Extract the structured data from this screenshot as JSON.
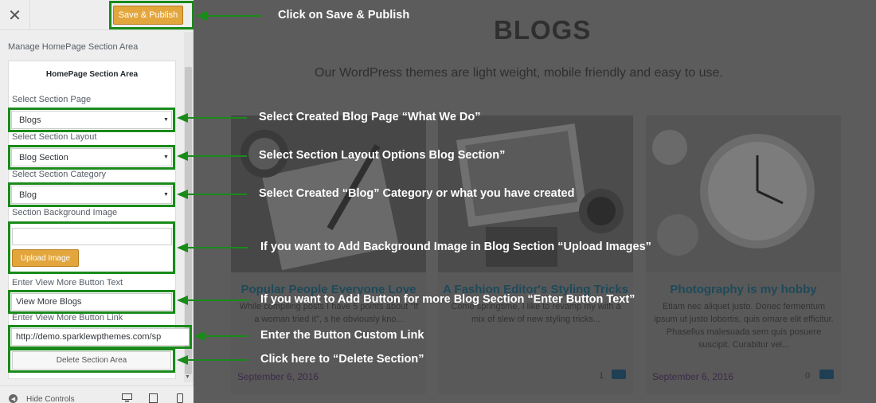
{
  "panel": {
    "close_icon": "close-icon",
    "save_label": "Save & Publish",
    "section_crumb": "Manage HomePage Section Area",
    "area_title": "HomePage Section Area",
    "fields": {
      "section_page_label": "Select Section Page",
      "section_page_value": "Blogs",
      "section_layout_label": "Select Section Layout",
      "section_layout_value": "Blog Section",
      "section_category_label": "Select Section Category",
      "section_category_value": "Blog",
      "bg_image_label": "Section Background Image",
      "upload_label": "Upload Image",
      "view_more_text_label": "Enter View More Button Text",
      "view_more_text_value": "View More Blogs",
      "view_more_link_label": "Enter View More Button Link",
      "view_more_link_value": "http://demo.sparklewpthemes.com/sp",
      "delete_label": "Delete Section Area"
    },
    "footer": {
      "hide_label": "Hide Controls",
      "devices": [
        "desktop-icon",
        "tablet-icon",
        "mobile-icon"
      ]
    },
    "accent_color": "#e3a63d"
  },
  "preview": {
    "heading": "BLOGS",
    "subheading": "Our WordPress themes are light weight, mobile friendly and easy to use.",
    "cards": [
      {
        "title": "Popular People Everyone Love",
        "excerpt": "While compiling posts I have 5 points about \"If a woman tried it\", s he obviously kno...",
        "date": "September 6, 2016",
        "comments": "",
        "image": "notebook-desk-photo"
      },
      {
        "title": "A Fashion Editor's Styling Tricks",
        "excerpt": "Come springtime, I like to revamp my with a mix of slew of new styling tricks...",
        "date": "",
        "comments": "1",
        "image": "tablet-coffee-photo"
      },
      {
        "title": "Photography is my hobby",
        "excerpt": "Etiam nec aliquet justo. Donec fermentum ipsum ut justo lobortis, quis ornare elit efficitur. Phasellus malesuada sem quis posuere suscipit. Curabitur vel...",
        "date": "September 6, 2016",
        "comments": "0",
        "image": "pocket-watch-photo"
      }
    ]
  },
  "annotations": {
    "save": "Click on Save & Publish",
    "page": "Select Created Blog Page “What We Do”",
    "layout": "Select Section Layout Options Blog Section”",
    "category": "Select Created “Blog” Category or what you have created",
    "background": "If you want to Add Background Image in Blog Section “Upload Images”",
    "button_text": "If you want to Add Button for more  Blog Section “Enter Button Text”",
    "button_link": "Enter the Button Custom Link",
    "delete": "Click here to “Delete Section”",
    "color": "#1a8a1a"
  }
}
